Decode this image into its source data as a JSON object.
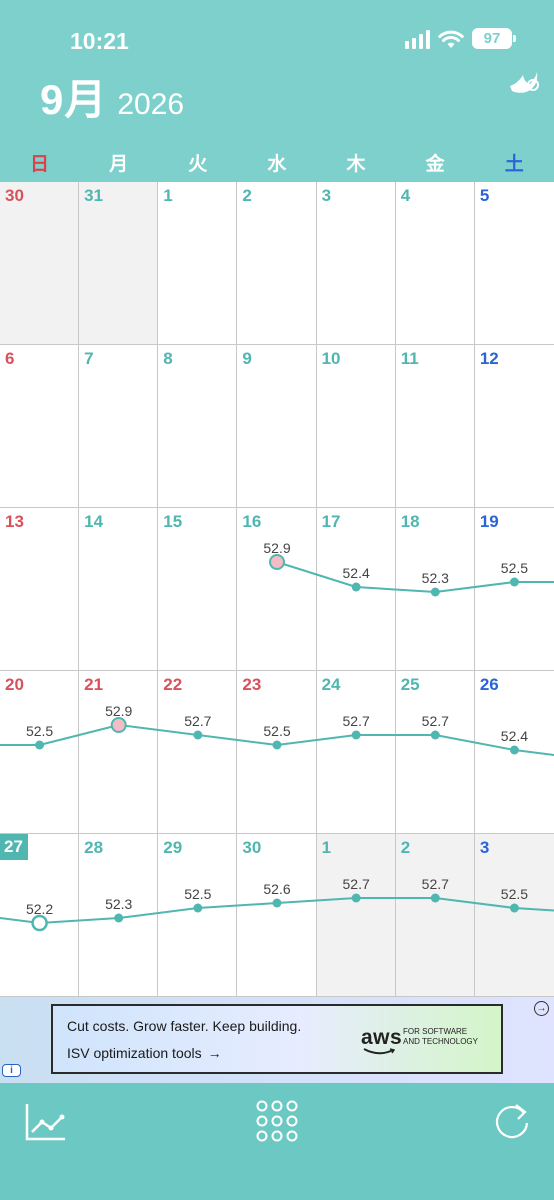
{
  "status": {
    "time": "10:21",
    "battery": "97"
  },
  "header": {
    "month": "9月",
    "year": "2026"
  },
  "weekdays": [
    "日",
    "月",
    "火",
    "水",
    "木",
    "金",
    "土"
  ],
  "calendar": {
    "weeks": [
      [
        {
          "d": "30",
          "c": "sun",
          "out": true
        },
        {
          "d": "31",
          "c": "",
          "out": true
        },
        {
          "d": "1",
          "c": ""
        },
        {
          "d": "2",
          "c": ""
        },
        {
          "d": "3",
          "c": ""
        },
        {
          "d": "4",
          "c": ""
        },
        {
          "d": "5",
          "c": "sat"
        }
      ],
      [
        {
          "d": "6",
          "c": "sun"
        },
        {
          "d": "7",
          "c": ""
        },
        {
          "d": "8",
          "c": ""
        },
        {
          "d": "9",
          "c": ""
        },
        {
          "d": "10",
          "c": ""
        },
        {
          "d": "11",
          "c": ""
        },
        {
          "d": "12",
          "c": "sat"
        }
      ],
      [
        {
          "d": "13",
          "c": "sun"
        },
        {
          "d": "14",
          "c": ""
        },
        {
          "d": "15",
          "c": ""
        },
        {
          "d": "16",
          "c": ""
        },
        {
          "d": "17",
          "c": ""
        },
        {
          "d": "18",
          "c": ""
        },
        {
          "d": "19",
          "c": "sat"
        }
      ],
      [
        {
          "d": "20",
          "c": "sun"
        },
        {
          "d": "21",
          "c": "red"
        },
        {
          "d": "22",
          "c": "red"
        },
        {
          "d": "23",
          "c": "red"
        },
        {
          "d": "24",
          "c": ""
        },
        {
          "d": "25",
          "c": ""
        },
        {
          "d": "26",
          "c": "sat"
        }
      ],
      [
        {
          "d": "27",
          "c": "today"
        },
        {
          "d": "28",
          "c": ""
        },
        {
          "d": "29",
          "c": ""
        },
        {
          "d": "30",
          "c": ""
        },
        {
          "d": "1",
          "c": "",
          "out": true
        },
        {
          "d": "2",
          "c": "",
          "out": true
        },
        {
          "d": "3",
          "c": "sat",
          "out": true
        }
      ]
    ]
  },
  "chart_data": {
    "type": "line",
    "series": [
      {
        "points": [
          {
            "day": 9,
            "value": 52.9,
            "marker": "pink-open"
          },
          {
            "day": 10,
            "value": 52.4
          },
          {
            "day": 11,
            "value": 52.3
          },
          {
            "day": 12,
            "value": 52.5
          },
          {
            "day": 13,
            "value": 52.5
          },
          {
            "day": 14,
            "value": 52.9,
            "marker": "pink"
          },
          {
            "day": 15,
            "value": 52.7
          },
          {
            "day": 16,
            "value": 52.5
          },
          {
            "day": 17,
            "value": 52.7
          },
          {
            "day": 18,
            "value": 52.7
          },
          {
            "day": 19,
            "value": 52.4
          },
          {
            "day": 20,
            "value": 52.2,
            "marker": "open"
          },
          {
            "day": 21,
            "value": 52.3
          },
          {
            "day": 22,
            "value": 52.5
          },
          {
            "day": 23,
            "value": 52.6
          },
          {
            "day": 24,
            "value": 52.7
          },
          {
            "day": 25,
            "value": 52.7
          },
          {
            "day": 26,
            "value": 52.5
          },
          {
            "day": 27,
            "value": 52.4
          }
        ]
      }
    ],
    "line_color": "#4fb7b0",
    "ylim": [
      52.0,
      53.0
    ]
  },
  "ad": {
    "line1": "Cut costs. Grow faster. Keep building.",
    "line2": "ISV optimization tools",
    "arrow": "→",
    "brand": "aws",
    "tag1": "FOR SOFTWARE",
    "tag2": "AND TECHNOLOGY",
    "info": "i",
    "close": "→"
  },
  "toolbar": {
    "icons": [
      "chart-icon",
      "grid-icon",
      "refresh-icon"
    ]
  },
  "colors": {
    "header": "#7dd0cc",
    "toolbar": "#6cc8c2",
    "accent": "#4fb7b0",
    "sunday": "#d9515b",
    "saturday": "#2b63d9"
  }
}
